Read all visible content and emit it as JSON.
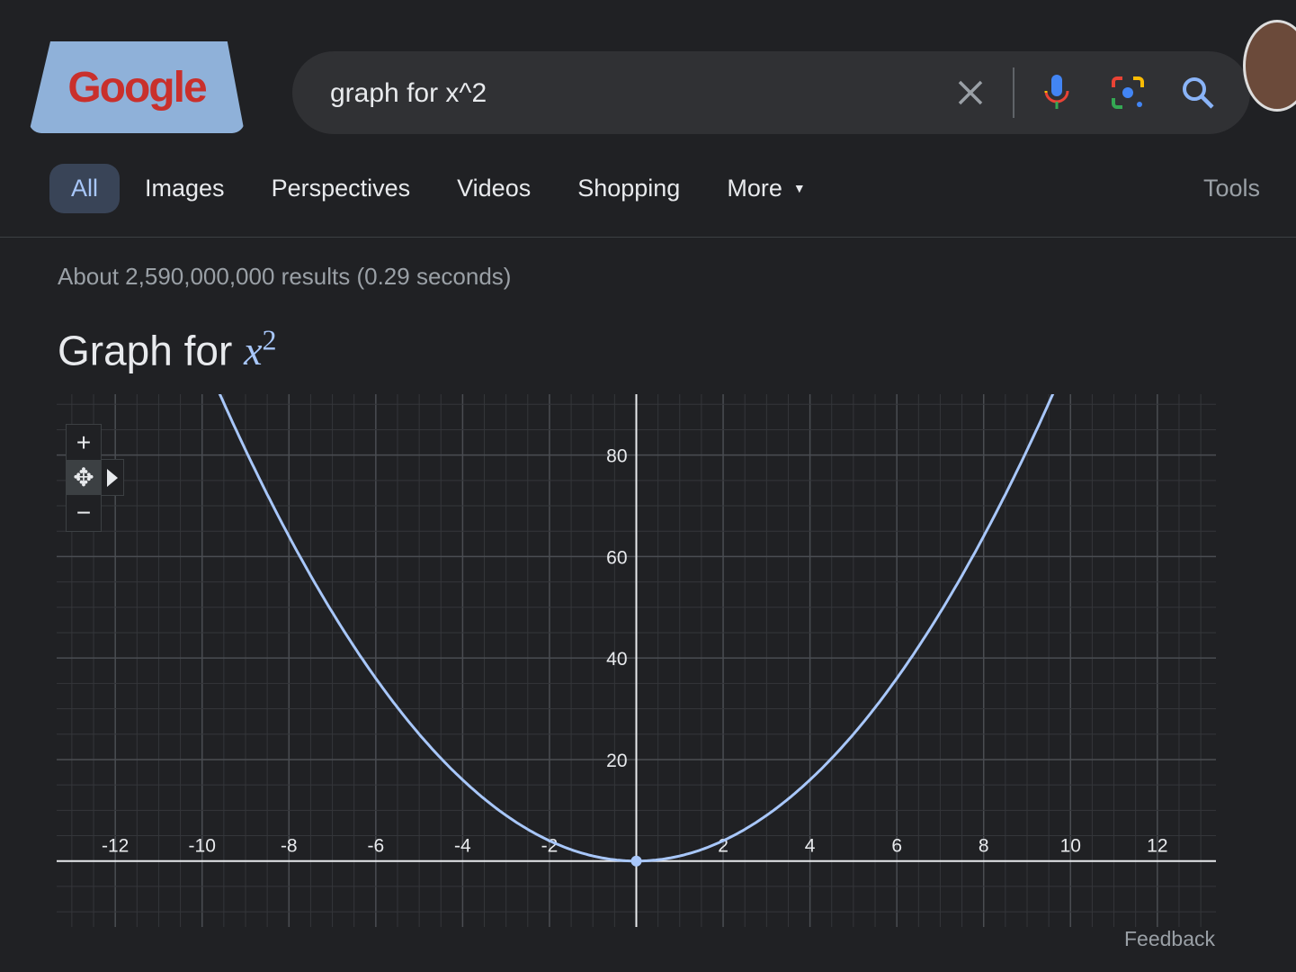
{
  "logo": {
    "text": "Google"
  },
  "search": {
    "query": "graph for x^2",
    "icons": [
      "close-icon",
      "microphone-icon",
      "lens-icon",
      "search-icon"
    ]
  },
  "tabs": [
    {
      "label": "All",
      "active": true
    },
    {
      "label": "Images"
    },
    {
      "label": "Perspectives"
    },
    {
      "label": "Videos"
    },
    {
      "label": "Shopping"
    },
    {
      "label": "More"
    }
  ],
  "tools_label": "Tools",
  "stats": "About 2,590,000,000 results (0.29 seconds)",
  "heading": {
    "prefix": "Graph for ",
    "var": "x",
    "exp": "2"
  },
  "controls": {
    "zoom_in": "+",
    "zoom_out": "−"
  },
  "feedback": "Feedback",
  "colors": {
    "curve": "#a8c7fa",
    "background": "#202124",
    "accent": "#a8c7fa"
  },
  "chart_data": {
    "type": "line",
    "function": "x^2",
    "xlim": [
      -13.35,
      13.35
    ],
    "ylim": [
      -13,
      92
    ],
    "xticks": [
      -12,
      -10,
      -8,
      -6,
      -4,
      -2,
      2,
      4,
      6,
      8,
      10,
      12
    ],
    "yticks": [
      20,
      40,
      60,
      80
    ],
    "grid": true,
    "highlight_point": [
      0,
      0
    ]
  }
}
